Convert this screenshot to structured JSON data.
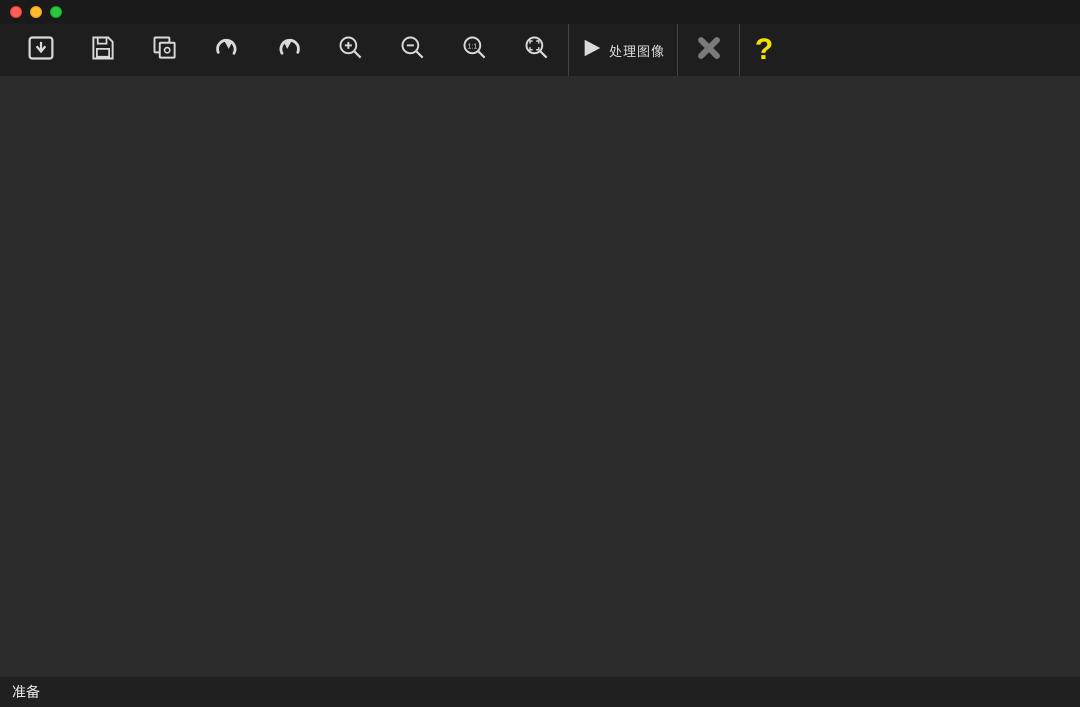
{
  "toolbar": {
    "open_label": "Open",
    "save_label": "Save",
    "save_as_label": "Save As",
    "undo_label": "Undo",
    "redo_label": "Redo",
    "zoom_in_label": "Zoom In",
    "zoom_out_label": "Zoom Out",
    "zoom_100_label": "1:1",
    "fit_label": "Fit",
    "process_label": "处理图像",
    "close_label": "Close",
    "help_label": "?"
  },
  "statusbar": {
    "text": "准备"
  },
  "colors": {
    "toolbar_bg": "#1e1e1e",
    "canvas_bg": "#2c2c2c",
    "status_bg": "#202020",
    "icon": "#d9d9d9",
    "accent_yellow": "#f5e100"
  }
}
